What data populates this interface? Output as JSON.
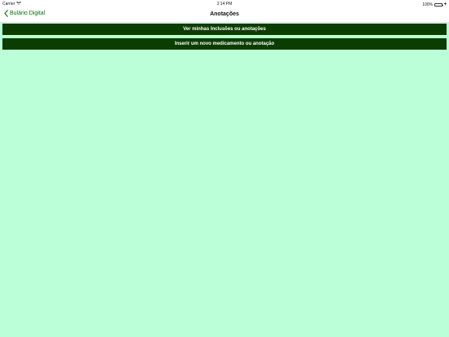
{
  "status_bar": {
    "carrier": "Carrier",
    "time": "2:14 PM",
    "battery": "100%"
  },
  "nav": {
    "back_label": "Bulário Digital",
    "title": "Anotações"
  },
  "actions": {
    "view_label": "Ver minhas Inclusões ou anotações",
    "insert_label": "Inserir um novo medicamento ou anotação"
  },
  "colors": {
    "background": "#bbffd9",
    "button": "#0c3d00",
    "accent": "#0a6b0a"
  }
}
